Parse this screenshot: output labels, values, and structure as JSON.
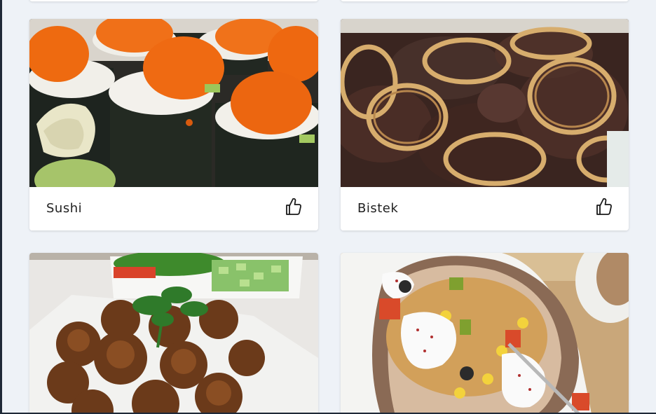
{
  "recipes": [
    {
      "name": "Sushi",
      "like_icon": "thumbs-up-icon"
    },
    {
      "name": "Bistek",
      "like_icon": "thumbs-up-icon"
    },
    {
      "name": "",
      "like_icon": "thumbs-up-icon"
    },
    {
      "name": "",
      "like_icon": "thumbs-up-icon"
    }
  ],
  "colors": {
    "page_background": "#eef2f7",
    "card_background": "#ffffff",
    "text": "#222222"
  }
}
